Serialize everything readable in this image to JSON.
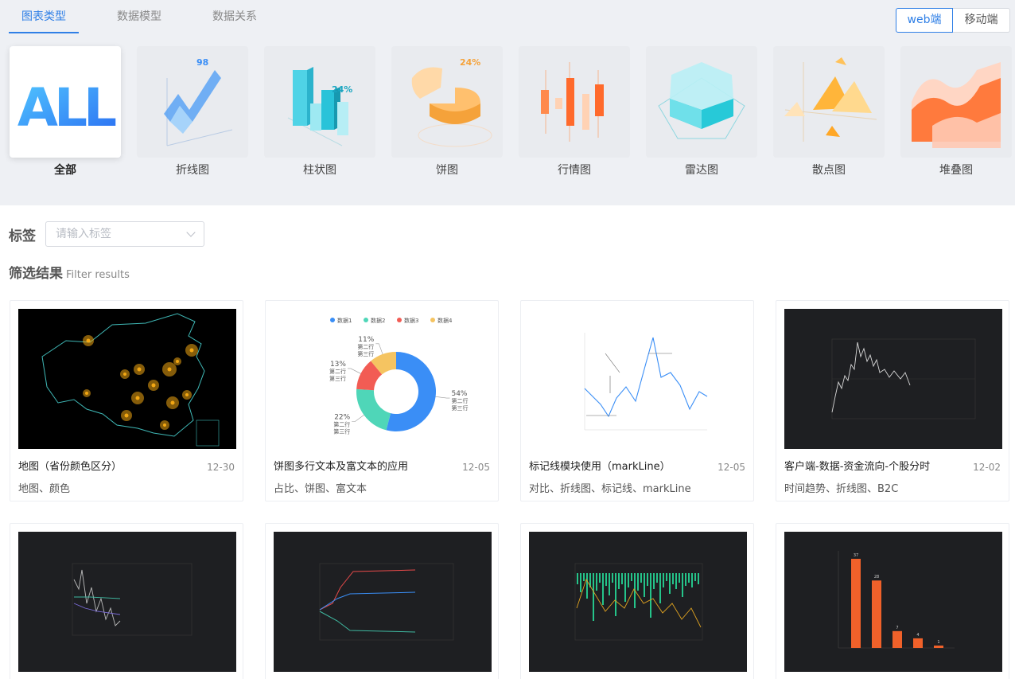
{
  "tabs": [
    "图表类型",
    "数据模型",
    "数据关系"
  ],
  "platform": [
    "web端",
    "移动端"
  ],
  "chart_types": [
    {
      "label": "全部",
      "icon": "all-icon"
    },
    {
      "label": "折线图",
      "icon": "line-chart-icon"
    },
    {
      "label": "柱状图",
      "icon": "bar-chart-icon"
    },
    {
      "label": "饼图",
      "icon": "pie-chart-icon"
    },
    {
      "label": "行情图",
      "icon": "candlestick-chart-icon"
    },
    {
      "label": "雷达图",
      "icon": "radar-chart-icon"
    },
    {
      "label": "散点图",
      "icon": "scatter-chart-icon"
    },
    {
      "label": "堆叠图",
      "icon": "stacked-chart-icon"
    }
  ],
  "thumb_text": {
    "all": "ALL",
    "line": "98",
    "bar": "24%",
    "pie": "24%"
  },
  "tag_filter": {
    "title": "标签",
    "placeholder": "请输入标签"
  },
  "results": {
    "title": "筛选结果",
    "subtitle": "Filter results"
  },
  "cards": [
    {
      "title": "地图（省份颜色区分）",
      "date": "12-30",
      "tags": "地图、颜色"
    },
    {
      "title": "饼图多行文本及富文本的应用",
      "date": "12-05",
      "tags": "占比、饼图、富文本"
    },
    {
      "title": "标记线模块使用（markLine）",
      "date": "12-05",
      "tags": "对比、折线图、标记线、markLine"
    },
    {
      "title": "客户端-数据-资金流向-个股分时",
      "date": "12-02",
      "tags": "时间趋势、折线图、B2C"
    }
  ],
  "donut": {
    "legend": [
      "数据1",
      "数据2",
      "数据3",
      "数据4"
    ],
    "colors": [
      "#3a8ef6",
      "#4fd6b8",
      "#f25c54",
      "#f5c461"
    ],
    "values": [
      54,
      22,
      13,
      11
    ],
    "labels": [
      "54%",
      "22%",
      "13%",
      "11%"
    ],
    "lines": [
      "第二行",
      "第三行"
    ]
  },
  "bars_preview": {
    "values": [
      37,
      28,
      7,
      4,
      1
    ],
    "labels": [
      "37",
      "28",
      "7",
      "4",
      "1"
    ]
  }
}
